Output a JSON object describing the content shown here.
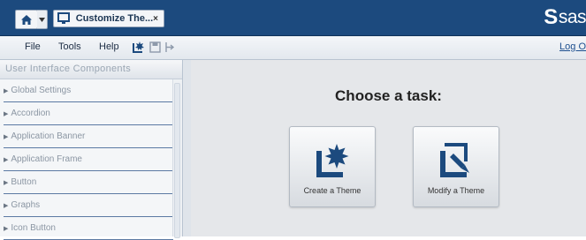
{
  "banner": {
    "tab_label": "Customize The...",
    "tab_close": "×",
    "brand_mark": "S",
    "brand_text": "sas"
  },
  "menubar": {
    "file": "File",
    "tools": "Tools",
    "help": "Help",
    "log_off": "Log O"
  },
  "sidebar": {
    "title": "User Interface Components",
    "items": [
      {
        "label": "Global Settings"
      },
      {
        "label": "Accordion"
      },
      {
        "label": "Application Banner"
      },
      {
        "label": "Application Frame"
      },
      {
        "label": "Button"
      },
      {
        "label": "Graphs"
      },
      {
        "label": "Icon Button"
      }
    ]
  },
  "main": {
    "heading": "Choose a task:",
    "tasks": [
      {
        "label": "Create a Theme"
      },
      {
        "label": "Modify a Theme"
      }
    ]
  },
  "colors": {
    "banner": "#1c4a7e",
    "accent_icon": "#1c4a7e"
  }
}
